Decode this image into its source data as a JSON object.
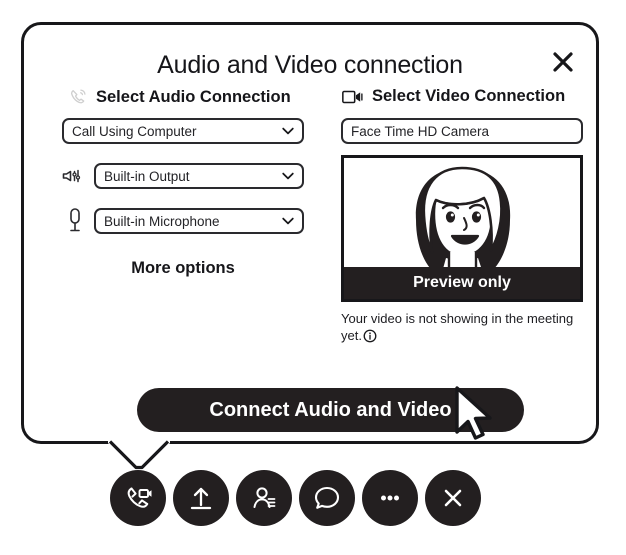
{
  "dialog": {
    "title": "Audio and Video connection",
    "close_icon": "close-icon",
    "audio": {
      "heading": "Select Audio Connection",
      "heading_icon": "headset-phone-icon",
      "connection_value": "Call Using Computer",
      "output_icon": "speaker-icon",
      "output_value": "Built-in Output",
      "microphone_icon": "microphone-icon",
      "microphone_value": "Built-in Microphone",
      "more_options_label": "More options"
    },
    "video": {
      "heading": "Select Video Connection",
      "heading_icon": "video-camera-icon",
      "camera_value": "Face Time HD Camera",
      "preview_label": "Preview only",
      "note": "Your video is not showing in the meeting yet.",
      "note_icon": "info-icon"
    },
    "connect_button_label": "Connect Audio and Video"
  },
  "toolbar": {
    "buttons": [
      {
        "name": "audio-video-button",
        "icon": "phone-video-icon"
      },
      {
        "name": "share-button",
        "icon": "upload-arrow-icon"
      },
      {
        "name": "participants-button",
        "icon": "participants-icon"
      },
      {
        "name": "chat-button",
        "icon": "chat-bubble-icon"
      },
      {
        "name": "more-button",
        "icon": "ellipsis-icon"
      },
      {
        "name": "leave-button",
        "icon": "close-x-icon"
      }
    ]
  },
  "cursor": {
    "icon": "mouse-pointer-icon"
  },
  "colors": {
    "ink": "#231f20",
    "outline": "#17171a",
    "background": "#ffffff",
    "muted_icon": "#cccccc"
  }
}
